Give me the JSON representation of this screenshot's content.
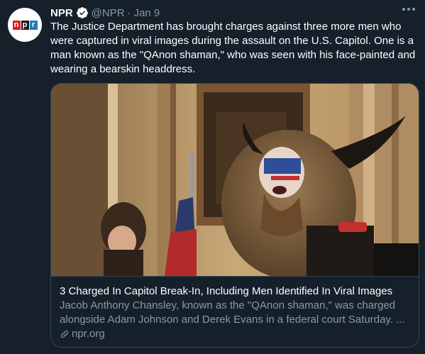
{
  "author": {
    "display_name": "NPR",
    "handle": "@NPR",
    "separator": "·",
    "date": "Jan 9",
    "avatar_letters": [
      "n",
      "p",
      "r"
    ]
  },
  "tweet": {
    "text": "The Justice Department has brought charges against three more men who were captured in viral images during the assault on the U.S. Capitol. One is a man known as the \"QAnon shaman,\" who was seen with his face-painted and wearing a bearskin headdress."
  },
  "card": {
    "title": "3 Charged In Capitol Break-In, Including Men Identified In Viral Images",
    "description": "Jacob Anthony Chansley, known as the \"QAnon shaman,\" was charged alongside Adam Johnson and Derek Evans in a federal court Saturday. ...",
    "domain": "npr.org"
  },
  "colors": {
    "background": "#15202b",
    "text": "#ffffff",
    "secondary": "#8899a6",
    "border": "#38444d",
    "verified": "#ffffff",
    "npr_red": "#d62021",
    "npr_black": "#1b1b1b",
    "npr_blue": "#237bbd"
  },
  "icons": {
    "verified": "verified-badge-icon",
    "more": "more-options-icon",
    "link": "link-icon"
  }
}
